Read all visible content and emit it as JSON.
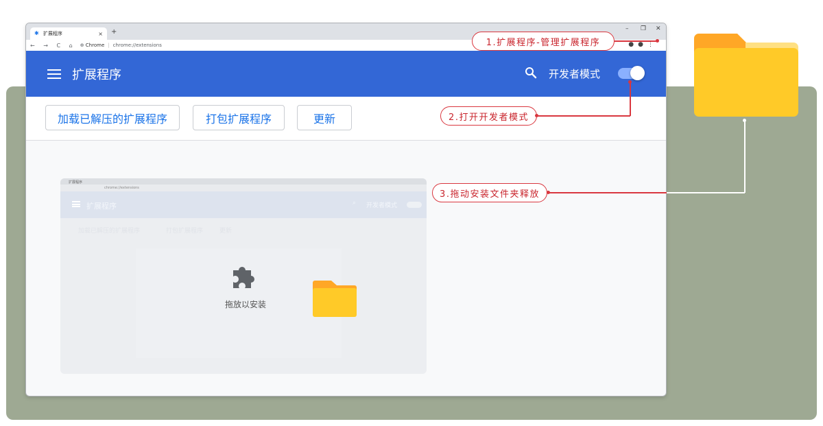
{
  "browser": {
    "tab_title": "扩展程序",
    "tab_close": "×",
    "new_tab": "+",
    "window_controls": [
      "–",
      "❐",
      "✕"
    ],
    "nav_buttons": "← → C ⌂",
    "site_label": "Chrome",
    "url": "chrome://extensions"
  },
  "appbar": {
    "title": "扩展程序",
    "dev_mode_label": "开发者模式",
    "dev_mode_on": true
  },
  "actions": {
    "load_unpacked": "加载已解压的扩展程序",
    "pack": "打包扩展程序",
    "update": "更新"
  },
  "inner_screenshot": {
    "tab_title": "扩展程序",
    "url": "chrome://extensions",
    "title": "扩展程序",
    "dev_mode_label": "开发者模式",
    "buttons": [
      "加载已解压的扩展程序",
      "打包扩展程序",
      "更新"
    ],
    "drop_label": "拖放以安装"
  },
  "callouts": {
    "step1": "1.扩展程序-管理扩展程序",
    "step2": "2.打开开发者模式",
    "step3": "3.拖动安装文件夹释放"
  },
  "colors": {
    "appbar": "#3367d6",
    "callout_red": "#d9363e",
    "backdrop": "#9ea993",
    "folder": "#ffc928"
  }
}
